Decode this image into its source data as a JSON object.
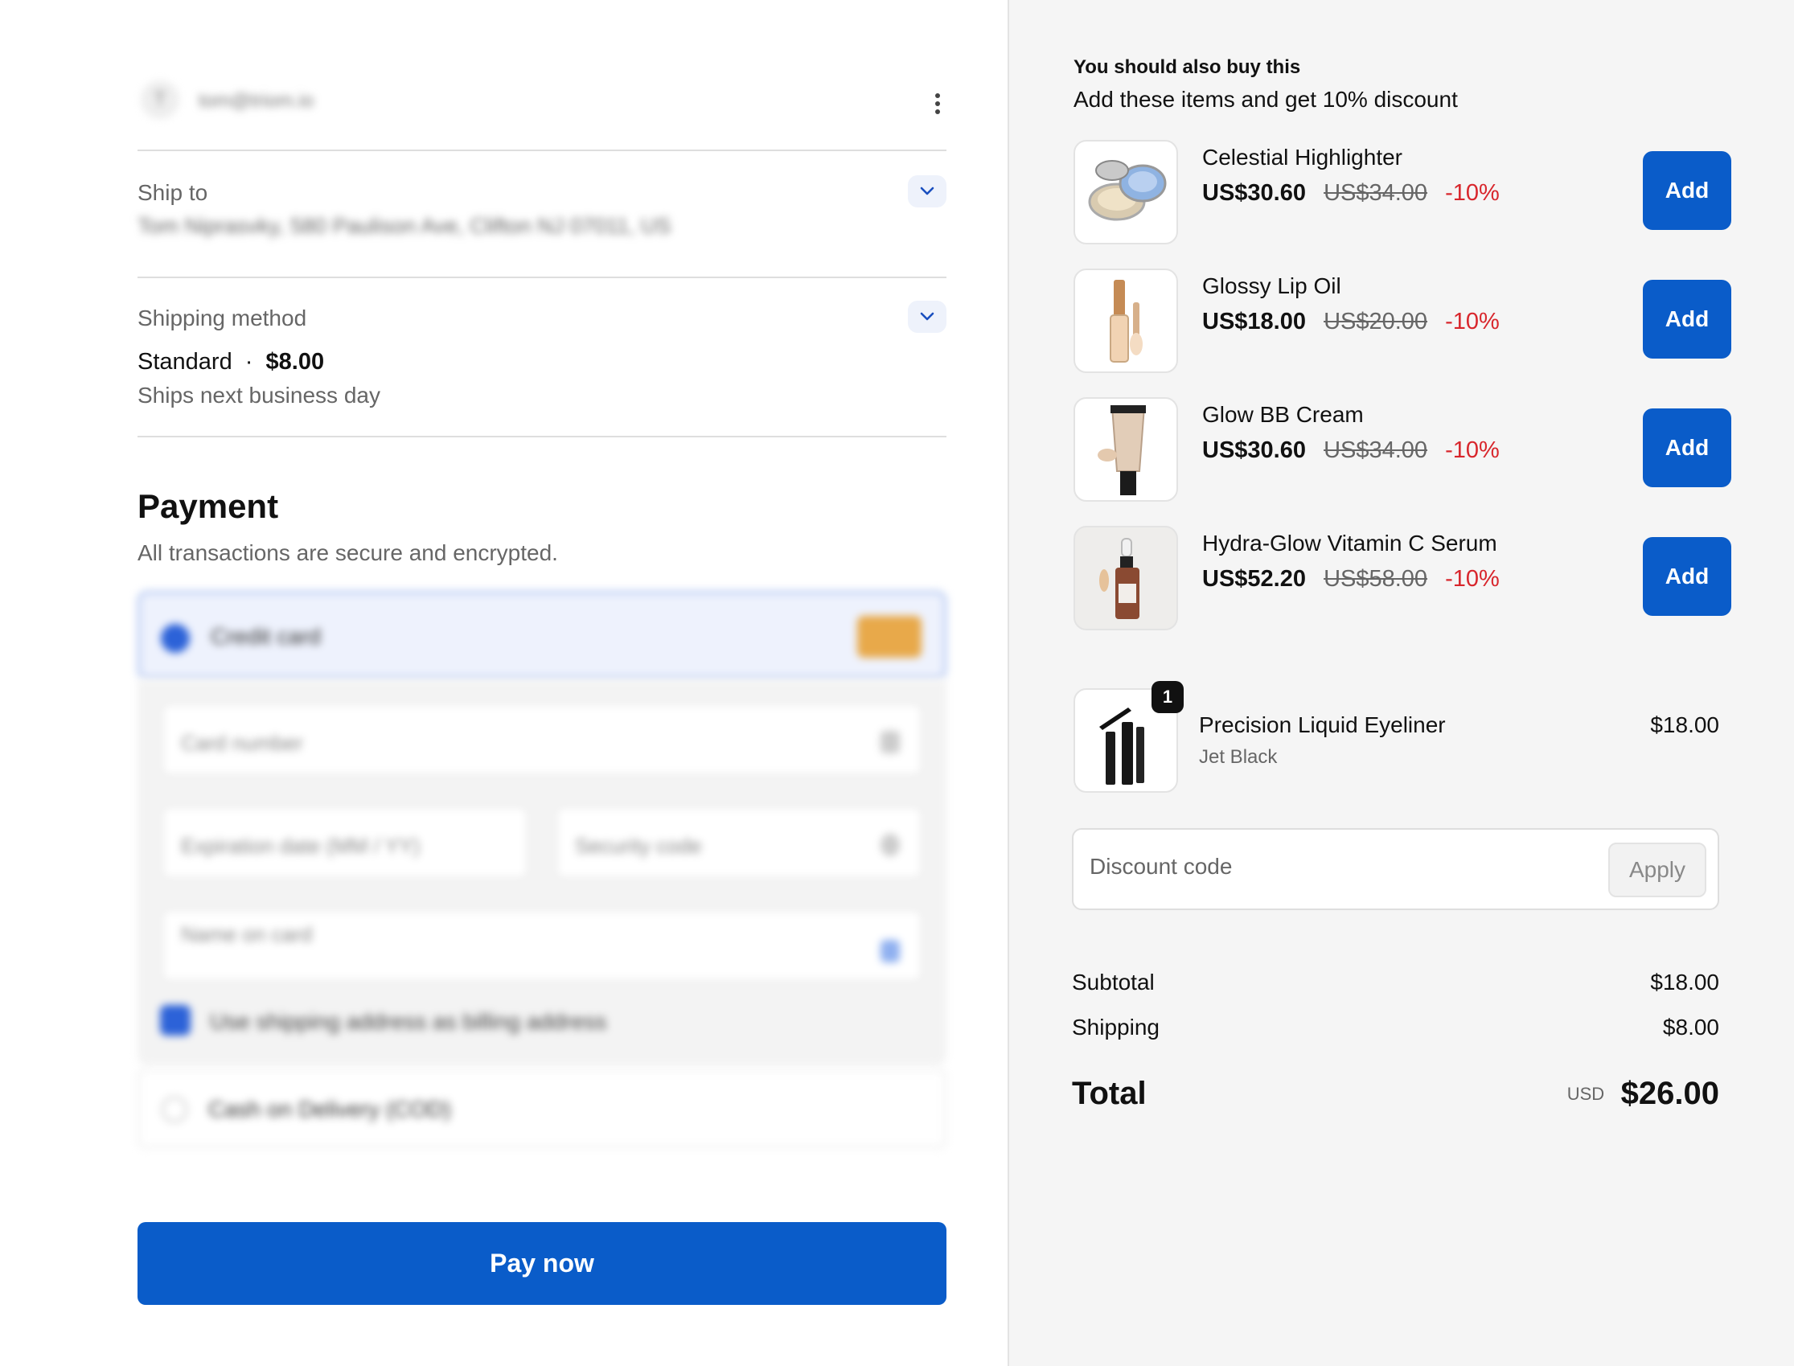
{
  "account": {
    "avatar_letter": "T",
    "email": "tom@triom.io"
  },
  "ship_to": {
    "label": "Ship to",
    "address": "Tom Niprasvky, 580 Paulison Ave, Clifton NJ 07011, US"
  },
  "shipping_method": {
    "label": "Shipping method",
    "name": "Standard",
    "separator": "·",
    "price": "$8.00",
    "note": "Ships next business day"
  },
  "payment": {
    "title": "Payment",
    "subtitle": "All transactions are secure and encrypted.",
    "credit_card_label": "Credit card",
    "card_number_placeholder": "Card number",
    "expiration_placeholder": "Expiration date (MM / YY)",
    "security_code_placeholder": "Security code",
    "name_on_card_placeholder": "Name on card",
    "billing_checkbox_label": "Use shipping address as billing address",
    "cod_label": "Cash on Delivery (COD)",
    "pay_button": "Pay now"
  },
  "upsell": {
    "title": "You should also buy this",
    "subtitle": "Add these items and get 10% discount",
    "add_label": "Add",
    "products": [
      {
        "name": "Celestial Highlighter",
        "price": "US$30.60",
        "old_price": "US$34.00",
        "discount": "-10%",
        "icon": "highlighter-compact-image"
      },
      {
        "name": "Glossy Lip Oil",
        "price": "US$18.00",
        "old_price": "US$20.00",
        "discount": "-10%",
        "icon": "lip-oil-image"
      },
      {
        "name": "Glow BB Cream",
        "price": "US$30.60",
        "old_price": "US$34.00",
        "discount": "-10%",
        "icon": "bb-cream-tube-image"
      },
      {
        "name": "Hydra-Glow Vitamin C Serum",
        "price": "US$52.20",
        "old_price": "US$58.00",
        "discount": "-10%",
        "icon": "serum-bottle-image"
      }
    ]
  },
  "cart": {
    "item": {
      "name": "Precision Liquid Eyeliner",
      "variant": "Jet Black",
      "price": "$18.00",
      "quantity": "1",
      "icon": "eyeliner-image"
    }
  },
  "discount": {
    "placeholder": "Discount code",
    "apply_label": "Apply"
  },
  "summary": {
    "subtotal_label": "Subtotal",
    "subtotal": "$18.00",
    "shipping_label": "Shipping",
    "shipping": "$8.00",
    "total_label": "Total",
    "currency": "USD",
    "total": "$26.00"
  },
  "colors": {
    "primary": "#0a5cc9",
    "discount_red": "#d8262c",
    "panel_bg": "#f5f5f5"
  }
}
